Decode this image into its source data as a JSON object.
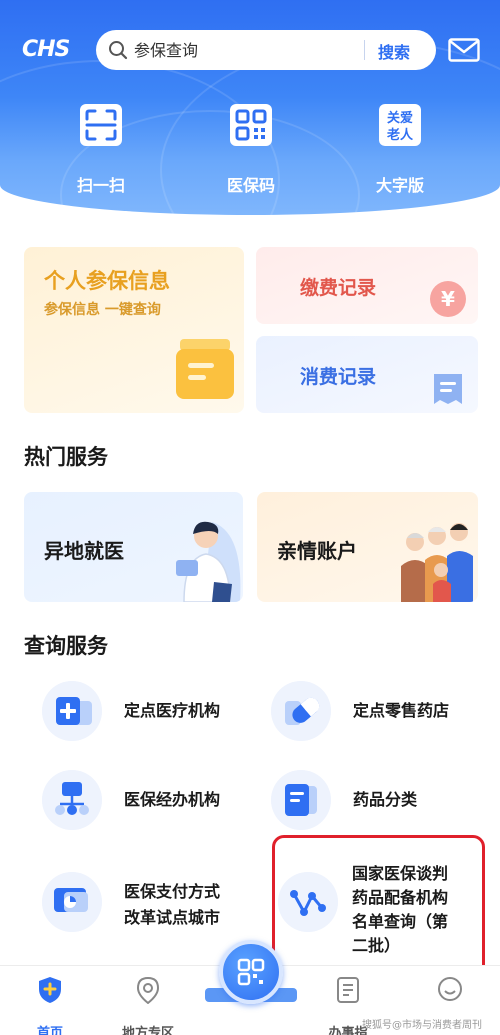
{
  "header": {
    "logo_text": "CHS",
    "search_placeholder": "参保查询",
    "search_button": "搜索",
    "quick_actions": [
      {
        "label": "扫一扫",
        "icon": "scan-icon"
      },
      {
        "label": "医保码",
        "icon": "qr-code-icon"
      },
      {
        "label": "大字版",
        "icon": "elderly-mode-icon",
        "icon_text_1": "关爱",
        "icon_text_2": "老人"
      }
    ]
  },
  "cards": {
    "personal": {
      "title": "个人参保信息",
      "subtitle": "参保信息 一键查询"
    },
    "payment": {
      "title": "缴费记录"
    },
    "spending": {
      "title": "消费记录"
    }
  },
  "hot_services": {
    "title": "热门服务",
    "items": [
      {
        "label": "异地就医"
      },
      {
        "label": "亲情账户"
      }
    ]
  },
  "query_services": {
    "title": "查询服务",
    "items": [
      {
        "label": "定点医疗机构",
        "icon": "hospital-plus-icon"
      },
      {
        "label": "定点零售药店",
        "icon": "pill-icon"
      },
      {
        "label": "医保经办机构",
        "icon": "org-chart-icon"
      },
      {
        "label": "药品分类",
        "icon": "document-icon"
      },
      {
        "label_line1": "医保支付方式",
        "label_line2": "改革试点城市",
        "icon": "pie-chart-icon"
      },
      {
        "label_line1": "国家医保谈判",
        "label_line2": "药品配备机构",
        "label_line3": "名单查询（第",
        "label_line4": "二批）",
        "icon": "network-node-icon"
      }
    ]
  },
  "bottom_nav": {
    "items": [
      {
        "label": "首页",
        "icon": "home-shield-icon"
      },
      {
        "label": "地方专区",
        "icon": "location-pin-icon"
      },
      {
        "label": "办事指",
        "icon": "guide-doc-icon"
      },
      {
        "label": "",
        "icon": "profile-icon"
      }
    ]
  },
  "watermark": "搜狐号@市场与消费者周刊",
  "colors": {
    "primary_blue": "#2f6ff2",
    "orange": "#e8a020",
    "red": "#e2574c",
    "highlight_red": "#e0202b"
  }
}
